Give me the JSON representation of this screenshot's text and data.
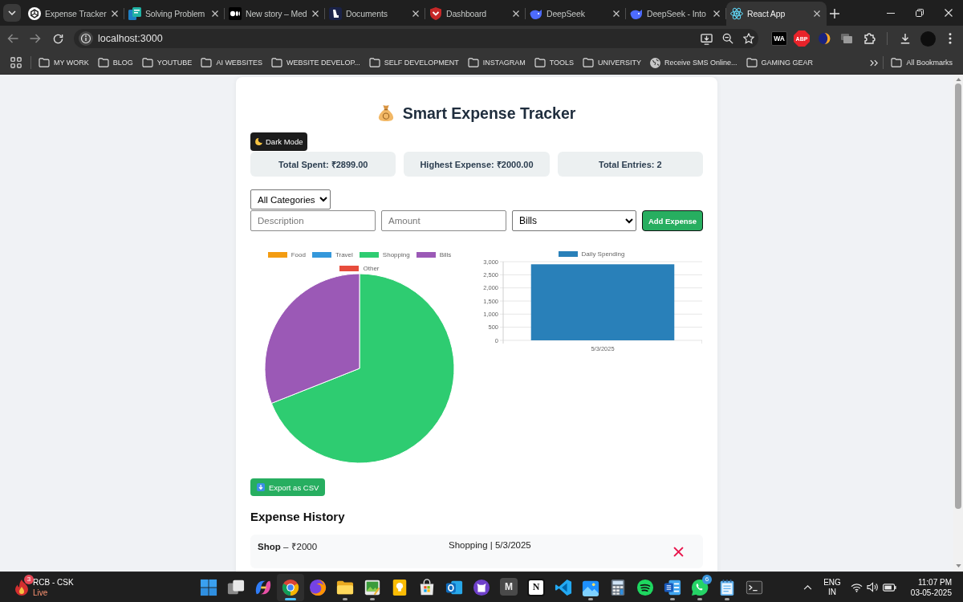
{
  "browser": {
    "tabs": [
      {
        "title": "Expense Tracker",
        "kind": "knot",
        "selected": false
      },
      {
        "title": "Solving Problem",
        "kind": "tiles",
        "selected": false
      },
      {
        "title": "New story – Med",
        "kind": "ellipses",
        "selected": false
      },
      {
        "title": "Documents",
        "kind": "monogram",
        "selected": false
      },
      {
        "title": "Dashboard",
        "kind": "shield",
        "selected": false
      },
      {
        "title": "DeepSeek",
        "kind": "whale",
        "selected": false
      },
      {
        "title": "DeepSeek - Into",
        "kind": "whale",
        "selected": false
      },
      {
        "title": "React App",
        "kind": "atom",
        "selected": true
      }
    ],
    "address": "localhost:3000",
    "extensions": [
      {
        "kind": "tile",
        "label": "WA"
      },
      {
        "kind": "octagon",
        "label": "ABP"
      },
      {
        "kind": "crescent"
      },
      {
        "kind": "cards"
      },
      {
        "kind": "puzzle"
      }
    ],
    "bookmarks": [
      {
        "kind": "folder",
        "label": "MY WORK"
      },
      {
        "kind": "folder",
        "label": "BLOG"
      },
      {
        "kind": "folder",
        "label": "YOUTUBE"
      },
      {
        "kind": "folder",
        "label": "AI WEBSITES"
      },
      {
        "kind": "folder",
        "label": "WEBSITE DEVELOP..."
      },
      {
        "kind": "folder",
        "label": "SELF DEVELOPMENT"
      },
      {
        "kind": "folder",
        "label": "INSTAGRAM"
      },
      {
        "kind": "folder",
        "label": "TOOLS"
      },
      {
        "kind": "folder",
        "label": "UNIVERSITY"
      },
      {
        "kind": "site",
        "label": "Receive SMS Online..."
      },
      {
        "kind": "folder",
        "label": "GAMING GEAR"
      }
    ],
    "all_bookmarks": "All Bookmarks"
  },
  "app": {
    "title": "Smart Expense Tracker",
    "dark_mode_button": "Dark Mode",
    "stats": [
      "Total Spent: ₹2899.00",
      "Highest Expense: ₹2000.00",
      "Total Entries: 2"
    ],
    "filter": {
      "value": "All Categories"
    },
    "form": {
      "description": {
        "placeholder": "Description"
      },
      "amount": {
        "placeholder": "Amount"
      },
      "category": {
        "value": "Bills"
      },
      "submit": "Add Expense"
    },
    "charts": [
      {
        "chart_data": {
          "type": "pie",
          "categories": [
            "Food",
            "Travel",
            "Shopping",
            "Bills",
            "Other"
          ],
          "values": [
            0,
            0,
            69,
            31,
            0
          ],
          "colors": [
            "#f39c12",
            "#3498db",
            "#2ecc71",
            "#9b59b6",
            "#e74c3c"
          ],
          "legend": "top"
        }
      },
      {
        "chart_data": {
          "type": "bar",
          "categories": [
            "5/3/2025"
          ],
          "series": [
            {
              "name": "Daily Spending",
              "color": "#2980b9",
              "values": [
                2900
              ]
            }
          ],
          "ylim": [
            0,
            3000
          ],
          "yticks": [
            {
              "value": 0,
              "label": "0"
            },
            {
              "value": 500,
              "label": "500"
            },
            {
              "value": 1000,
              "label": "1,000"
            },
            {
              "value": 1500,
              "label": "1,500"
            },
            {
              "value": 2000,
              "label": "2,000"
            },
            {
              "value": 2500,
              "label": "2,500"
            },
            {
              "value": 3000,
              "label": "3,000"
            }
          ],
          "legend": "top",
          "grid": true
        }
      }
    ],
    "export_button": "Export as CSV",
    "history": {
      "heading": "Expense History",
      "rows": [
        {
          "label": "**Shop** – ₹2000",
          "meta": "Shopping | 5/3/2025"
        }
      ]
    }
  },
  "taskbar": {
    "widget": {
      "title": "RCB - CSK",
      "status": "Live",
      "badge": "3"
    },
    "apps": [
      {
        "kind": "windows",
        "running": false,
        "active": false
      },
      {
        "kind": "taskview",
        "running": false,
        "active": false
      },
      {
        "kind": "swirl",
        "running": false,
        "active": false
      },
      {
        "kind": "ring",
        "running": true,
        "active": true
      },
      {
        "kind": "fox",
        "running": false,
        "active": false
      },
      {
        "kind": "folder",
        "running": true,
        "active": false
      },
      {
        "kind": "picture",
        "running": true,
        "active": false
      },
      {
        "kind": "bulb",
        "running": false,
        "active": false
      },
      {
        "kind": "bag",
        "running": false,
        "active": false
      },
      {
        "kind": "mail",
        "running": false,
        "active": false
      },
      {
        "kind": "cat",
        "running": false,
        "active": false
      },
      {
        "kind": "letter",
        "label": "M",
        "running": false,
        "active": false
      },
      {
        "kind": "paper",
        "label": "N",
        "running": false,
        "active": false
      },
      {
        "kind": "code",
        "running": false,
        "active": false
      },
      {
        "kind": "photos",
        "running": true,
        "active": false
      },
      {
        "kind": "calculator",
        "running": false,
        "active": false
      },
      {
        "kind": "music",
        "running": false,
        "active": false
      },
      {
        "kind": "doc",
        "running": true,
        "active": false
      },
      {
        "kind": "chat",
        "badge": "6",
        "running": true,
        "active": false
      },
      {
        "kind": "notepad",
        "running": true,
        "active": false
      },
      {
        "kind": "terminal",
        "running": false,
        "active": false
      }
    ],
    "input_language": [
      "ENG",
      "IN"
    ],
    "time": "11:07 PM",
    "date": "03-05-2025"
  }
}
